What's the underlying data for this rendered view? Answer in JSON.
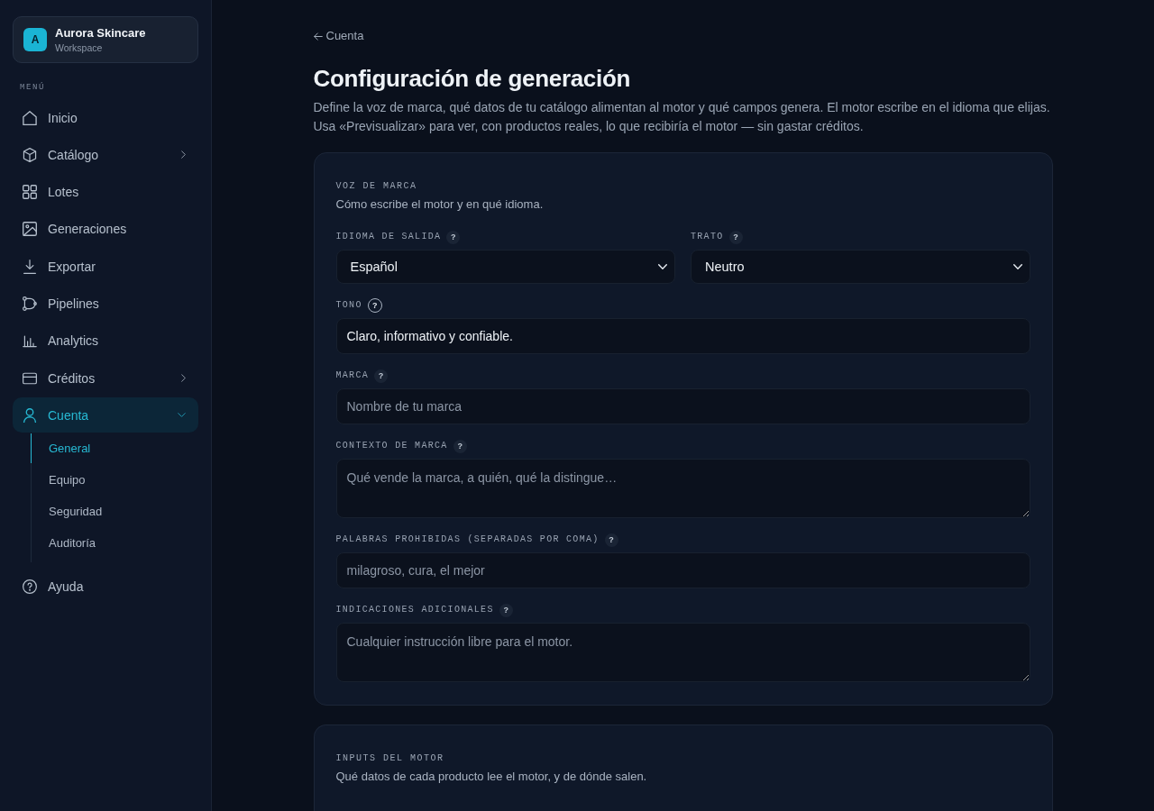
{
  "sidebar": {
    "workspace": {
      "initial": "A",
      "name": "Aurora Skincare",
      "subtitle": "Workspace"
    },
    "section_label": "MENÚ",
    "items": [
      {
        "label": "Inicio",
        "selected": false
      },
      {
        "label": "Catálogo",
        "selected": false,
        "expanded": false
      },
      {
        "label": "Lotes",
        "selected": false
      },
      {
        "label": "Generaciones",
        "selected": false
      },
      {
        "label": "Exportar",
        "selected": false
      },
      {
        "label": "Pipelines",
        "selected": false
      },
      {
        "label": "Analytics",
        "selected": false
      },
      {
        "label": "Créditos",
        "selected": false,
        "expanded": false
      },
      {
        "label": "Cuenta",
        "selected": true,
        "expanded": true,
        "children": [
          {
            "label": "General",
            "selected": true
          },
          {
            "label": "Equipo",
            "selected": false
          },
          {
            "label": "Seguridad",
            "selected": false
          },
          {
            "label": "Auditoría",
            "selected": false
          }
        ]
      },
      {
        "label": "Ayuda",
        "selected": false
      }
    ]
  },
  "page": {
    "back_link": "Cuenta",
    "title": "Configuración de generación",
    "description": "Define la voz de marca, qué datos de tu catálogo alimentan al motor y qué campos genera. El motor escribe en el idioma que elijas. Usa «Previsualizar» para ver, con productos reales, lo que recibiría el motor — sin gastar créditos.",
    "sections": [
      {
        "title": "VOZ DE MARCA",
        "subtitle": "Cómo escribe el motor y en qué idioma.",
        "rows": [
          {
            "fields": [
              {
                "kind": "select",
                "label": "IDIOMA DE SALIDA",
                "help": "?",
                "help_active": false,
                "value": "Español"
              },
              {
                "kind": "select",
                "label": "TRATO",
                "help": "?",
                "help_active": false,
                "value": "Neutro"
              }
            ]
          },
          {
            "fields": [
              {
                "kind": "input",
                "label": "TONO",
                "help": "?",
                "help_active": true,
                "value": "Claro, informativo y confiable."
              }
            ]
          },
          {
            "fields": [
              {
                "kind": "input",
                "label": "MARCA",
                "help": "?",
                "help_active": false,
                "placeholder": "Nombre de tu marca"
              }
            ]
          },
          {
            "fields": [
              {
                "kind": "textarea",
                "label": "CONTEXTO DE MARCA",
                "help": "?",
                "help_active": false,
                "placeholder": "Qué vende la marca, a quién, qué la distingue…"
              }
            ]
          },
          {
            "fields": [
              {
                "kind": "input",
                "label": "PALABRAS PROHIBIDAS (SEPARADAS POR COMA)",
                "help": "?",
                "help_active": false,
                "placeholder": "milagroso, cura, el mejor"
              }
            ]
          },
          {
            "fields": [
              {
                "kind": "textarea",
                "label": "INDICACIONES ADICIONALES",
                "help": "?",
                "help_active": false,
                "placeholder": "Cualquier instrucción libre para el motor."
              }
            ]
          }
        ]
      },
      {
        "title": "INPUTS DEL MOTOR",
        "subtitle": "Qué datos de cada producto lee el motor, y de dónde salen."
      }
    ]
  }
}
